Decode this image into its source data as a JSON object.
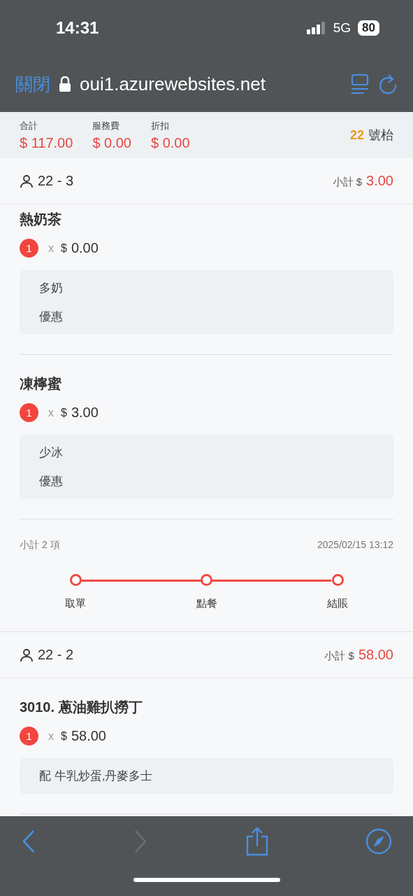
{
  "status_bar": {
    "time": "14:31",
    "network": "5G",
    "battery": "80"
  },
  "browser": {
    "close_label": "關閉",
    "url": "oui1.azurewebsites.net"
  },
  "summary": {
    "fields": [
      {
        "label": "合計",
        "value": "$ 117.00"
      },
      {
        "label": "服務費",
        "value": "$ 0.00"
      },
      {
        "label": "折扣",
        "value": "$ 0.00"
      }
    ],
    "table_number": "22",
    "table_label": "號枱"
  },
  "groups": [
    {
      "seat": "22 - 3",
      "subtotal_label": "小計 $",
      "subtotal": "3.00",
      "items": [
        {
          "name": "熱奶茶",
          "qty": "1",
          "times": "x",
          "currency": "$",
          "price": "0.00",
          "notes": [
            "多奶",
            "優惠"
          ]
        },
        {
          "name": "凍檸蜜",
          "qty": "1",
          "times": "x",
          "currency": "$",
          "price": "3.00",
          "notes": [
            "少冰",
            "優惠"
          ]
        }
      ],
      "footer": {
        "count_text": "小計 2 項",
        "datetime": "2025/02/15 13:12"
      },
      "steps": [
        {
          "label": "取單",
          "done": true
        },
        {
          "label": "點餐",
          "done": true
        },
        {
          "label": "結賬",
          "done": true
        }
      ]
    },
    {
      "seat": "22 - 2",
      "subtotal_label": "小計 $",
      "subtotal": "58.00",
      "items": [
        {
          "name": "3010. 蔥油雞扒撈丁",
          "qty": "1",
          "times": "x",
          "currency": "$",
          "price": "58.00",
          "notes": [
            "配 牛乳炒蛋,丹麥多士"
          ]
        }
      ]
    }
  ]
}
